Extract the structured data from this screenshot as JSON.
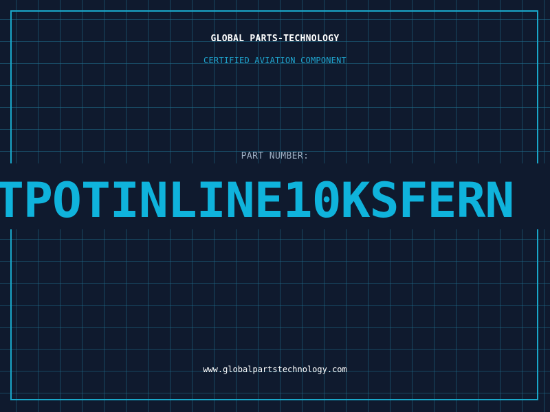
{
  "header": {
    "company": "GLOBAL PARTS-TECHNOLOGY",
    "subtitle": "CERTIFIED AVIATION COMPONENT"
  },
  "part": {
    "label": "PART NUMBER:",
    "number": "TPOTINLINE10KSFERN"
  },
  "footer": {
    "url": "www.globalpartstechnology.com"
  },
  "colors": {
    "background": "#0f1a2e",
    "accent": "#0fb3dc",
    "grid": "#1e6e8c",
    "frame": "#19a7c9"
  }
}
